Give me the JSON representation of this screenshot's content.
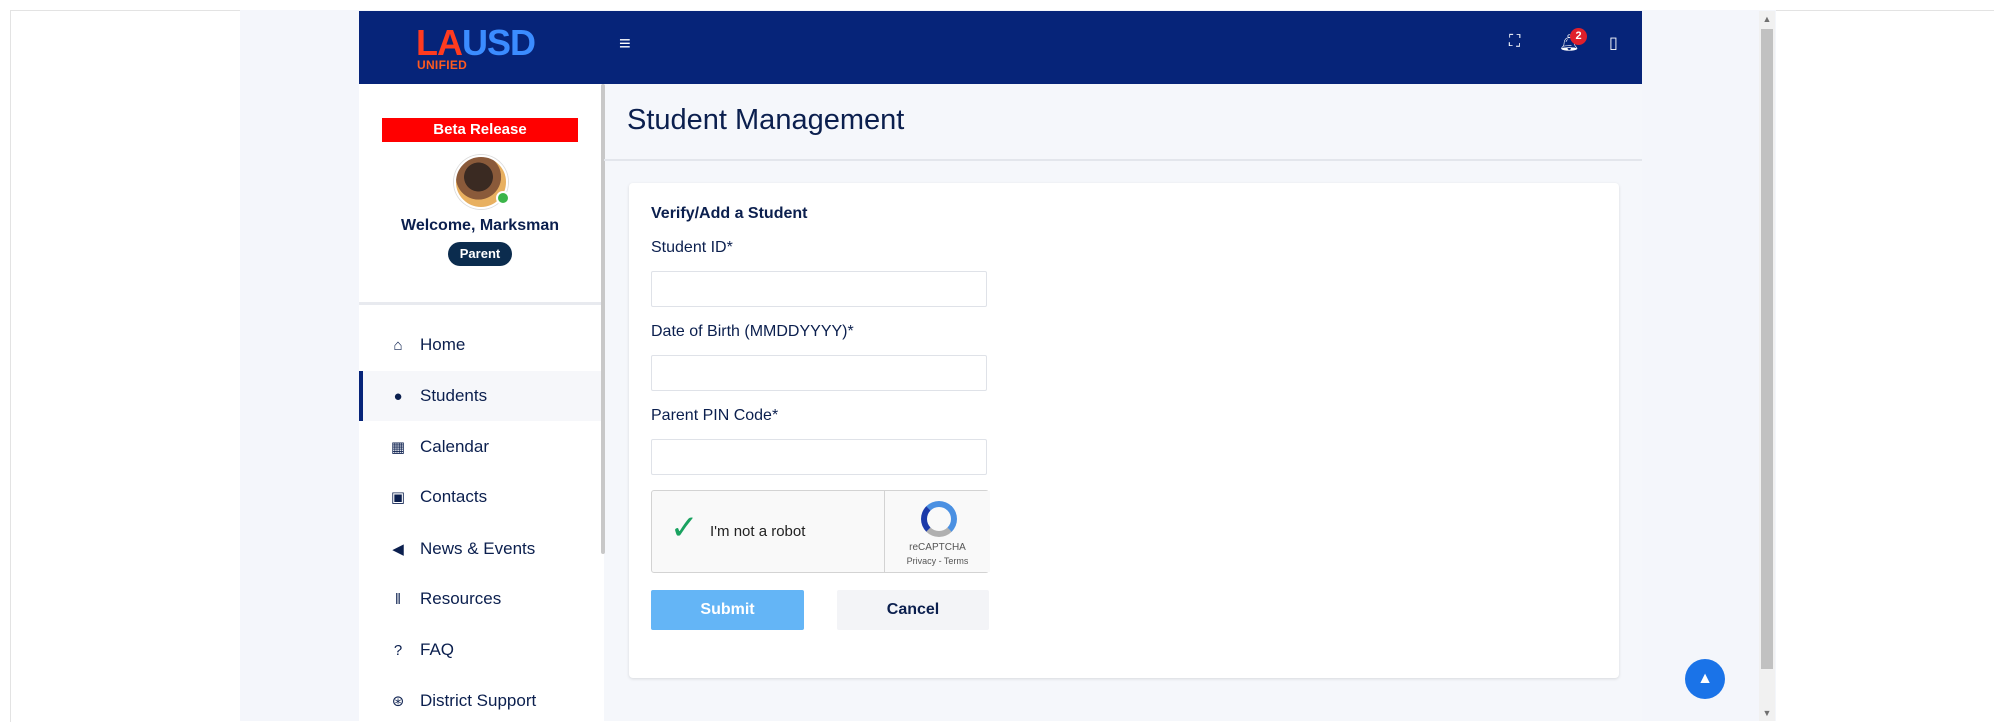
{
  "header": {
    "logo_letters_1": "LA",
    "logo_letters_2": "USD",
    "logo_sub": "UNIFIED",
    "menu_icon": "hamburger-icon",
    "fullscreen_icon": "fullscreen-icon",
    "notification_icon": "bell-icon",
    "notification_count": "2",
    "panel_icon": "panel-icon"
  },
  "sidebar": {
    "beta_label": "Beta Release",
    "welcome_text": "Welcome, Marksman",
    "role_label": "Parent",
    "items": [
      {
        "label": "Home",
        "icon": "home-icon",
        "glyph": "⌂"
      },
      {
        "label": "Students",
        "icon": "user-icon",
        "glyph": "●",
        "active": true
      },
      {
        "label": "Calendar",
        "icon": "calendar-icon",
        "glyph": "▦"
      },
      {
        "label": "Contacts",
        "icon": "contacts-icon",
        "glyph": "▣"
      },
      {
        "label": "News & Events",
        "icon": "megaphone-icon",
        "glyph": "◀"
      },
      {
        "label": "Resources",
        "icon": "books-icon",
        "glyph": "‖"
      },
      {
        "label": "FAQ",
        "icon": "question-icon",
        "glyph": "?"
      },
      {
        "label": "District Support",
        "icon": "lifebuoy-icon",
        "glyph": "⊛"
      }
    ]
  },
  "main": {
    "title": "Student Management",
    "form": {
      "title": "Verify/Add a Student",
      "student_id_label": "Student ID*",
      "student_id_value": "",
      "dob_label": "Date of Birth (MMDDYYYY)*",
      "dob_value": "",
      "pin_label": "Parent PIN Code*",
      "pin_value": "",
      "captcha_text": "I'm not a robot",
      "captcha_brand": "reCAPTCHA",
      "captcha_links": "Privacy - Terms",
      "submit_label": "Submit",
      "cancel_label": "Cancel"
    }
  },
  "colors": {
    "topbar": "#062479",
    "beta": "#ff0000",
    "submit": "#64b5f6",
    "accent": "#1a73e8"
  }
}
